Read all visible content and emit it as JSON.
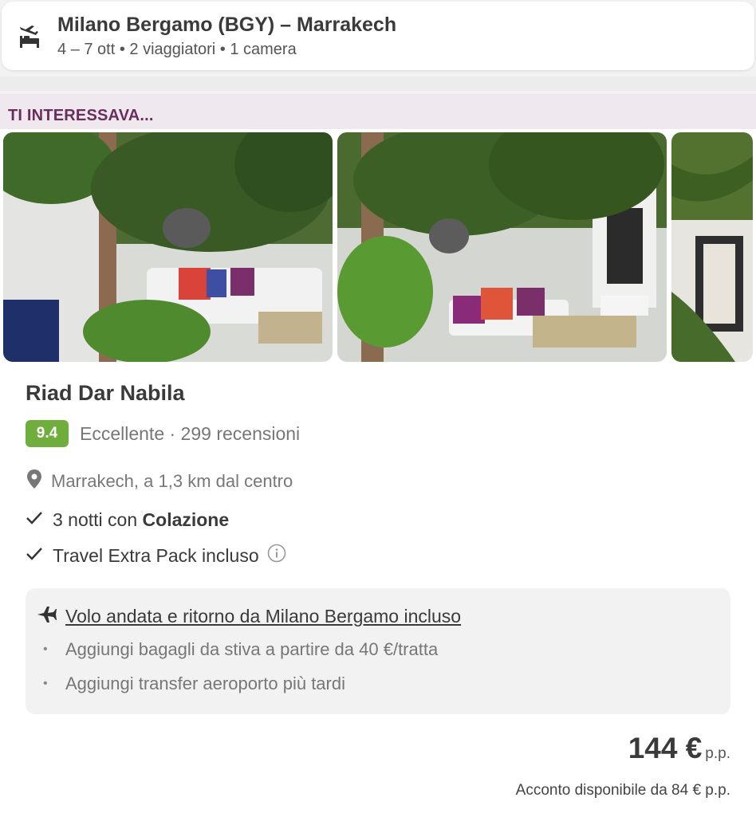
{
  "search": {
    "title": "Milano Bergamo (BGY) – Marrakech",
    "subtitle": "4 – 7 ott • 2 viaggiatori • 1 camera",
    "icon": "flight-hotel-icon"
  },
  "section": {
    "header": "TI INTERESSAVA..."
  },
  "hotel": {
    "name": "Riad Dar Nabila",
    "score": "9.4",
    "rating_text": "Eccellente · 299 recensioni",
    "location": "Marrakech, a 1,3 km dal centro",
    "features": [
      {
        "prefix": "3 notti con ",
        "bold": "Colazione"
      },
      {
        "prefix": "Travel Extra Pack incluso",
        "bold": ""
      }
    ],
    "score_color": "#6fae3c"
  },
  "flight": {
    "title": "Volo andata e ritorno da Milano Bergamo incluso",
    "bullets": [
      "Aggiungi bagagli da stiva a partire da 40 €/tratta",
      "Aggiungi transfer aeroporto più tardi"
    ]
  },
  "price": {
    "amount": "144 €",
    "unit": "p.p.",
    "deposit": "Acconto disponibile da 84 € p.p."
  },
  "colors": {
    "accent": "#6b2d5c",
    "header_bg": "#efe9ef"
  }
}
